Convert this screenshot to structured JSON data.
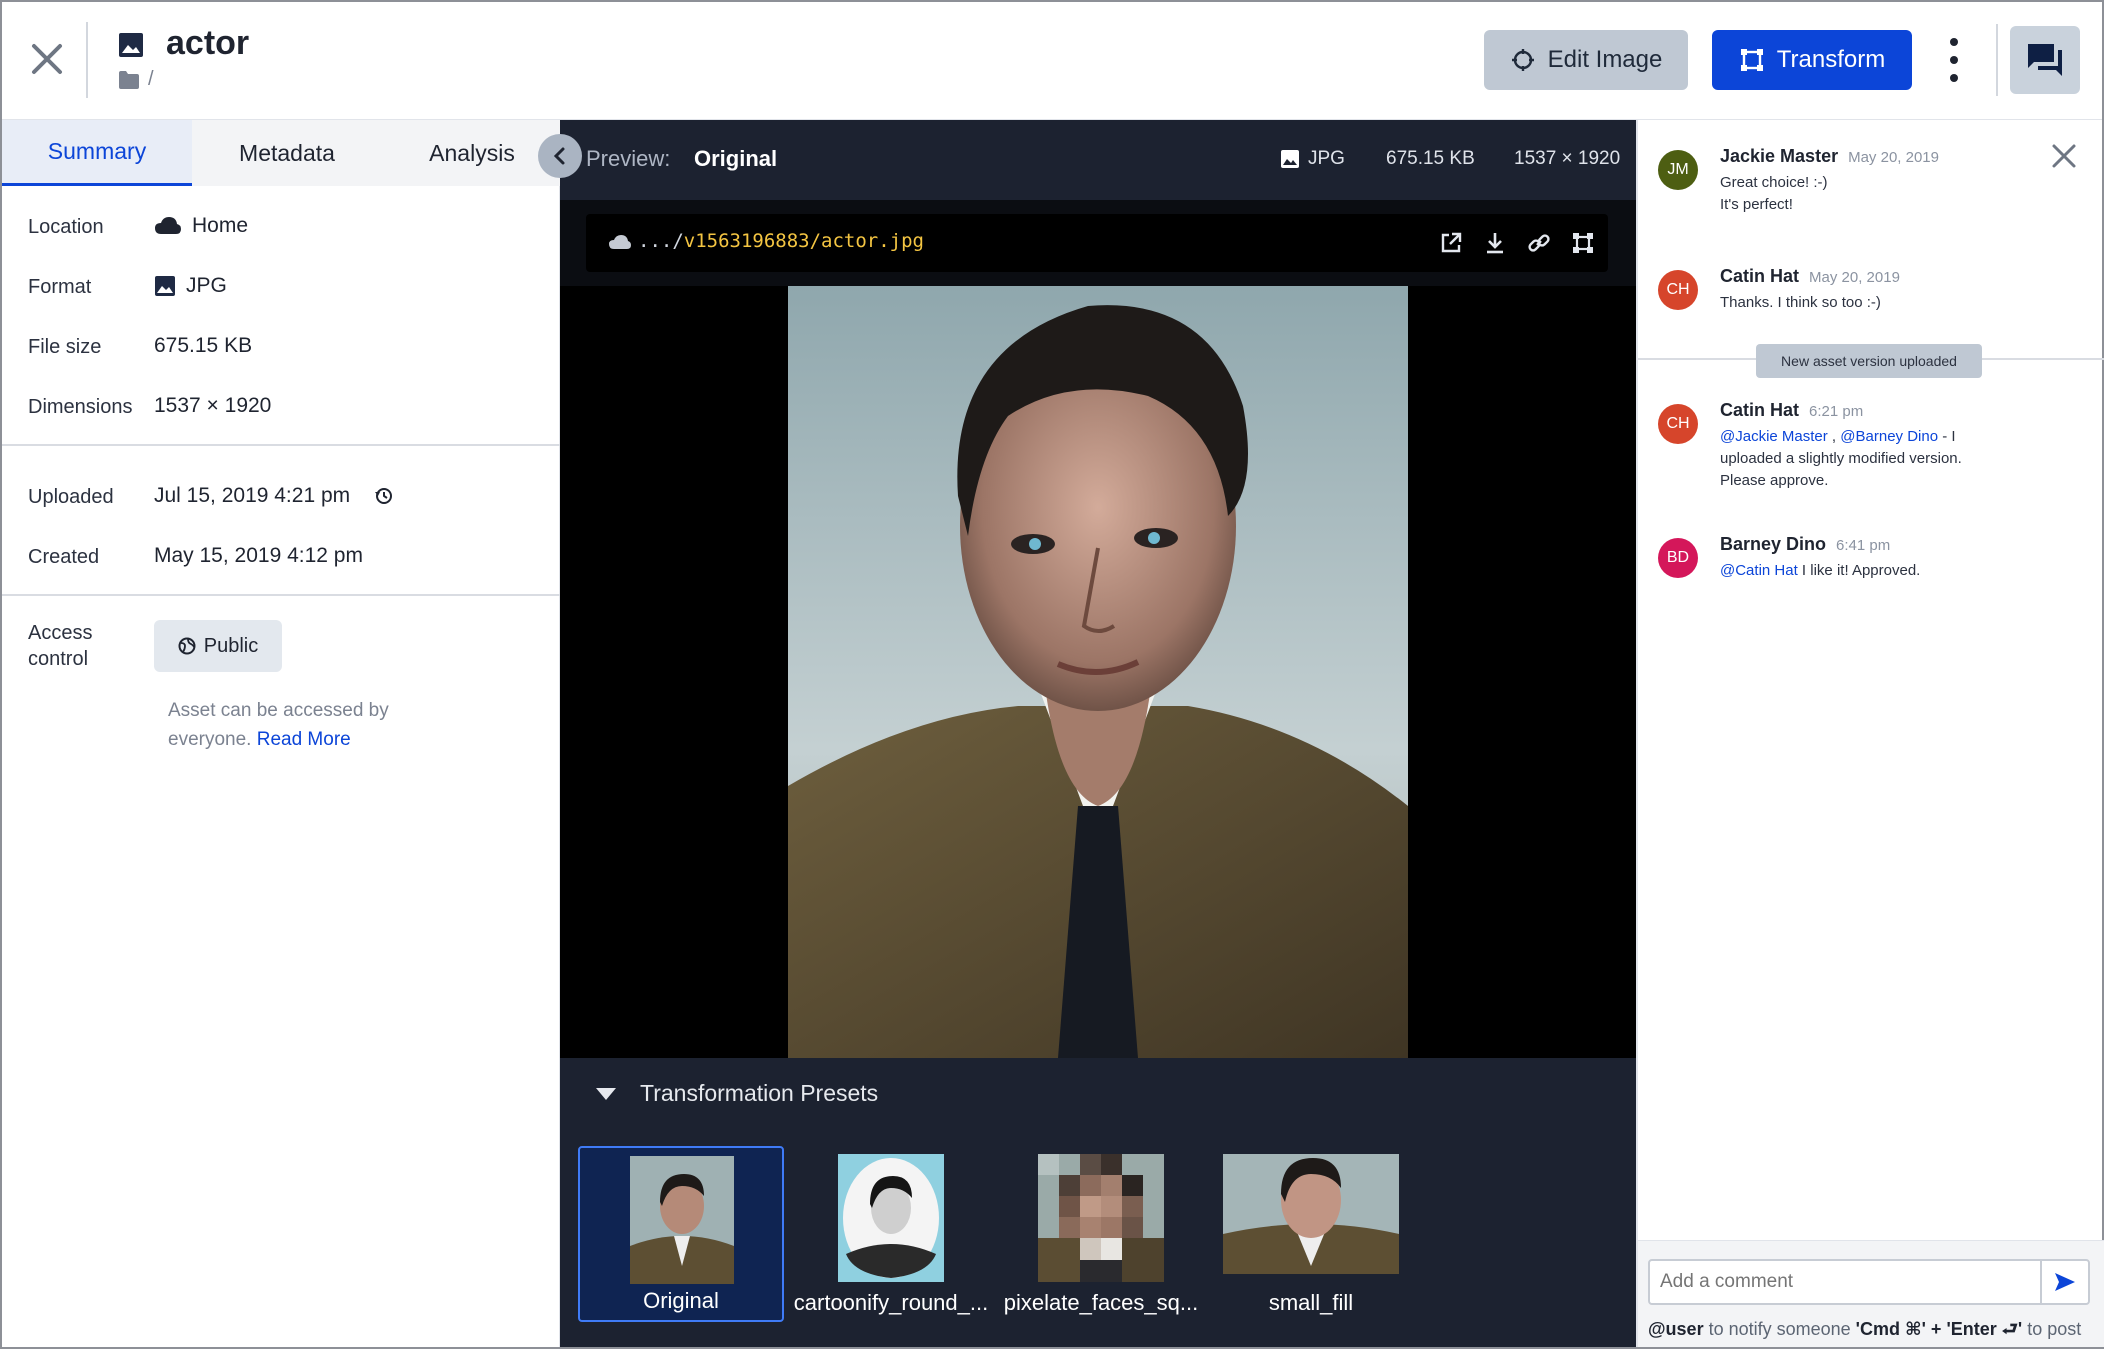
{
  "header": {
    "title": "actor",
    "breadcrumb": "/",
    "edit_button": "Edit Image",
    "transform_button": "Transform"
  },
  "tabs": [
    {
      "label": "Summary",
      "active": true
    },
    {
      "label": "Metadata",
      "active": false
    },
    {
      "label": "Analysis",
      "active": false
    }
  ],
  "summary": {
    "location_label": "Location",
    "location_value": "Home",
    "format_label": "Format",
    "format_value": "JPG",
    "filesize_label": "File size",
    "filesize_value": "675.15 KB",
    "dimensions_label": "Dimensions",
    "dimensions_value": "1537 × 1920",
    "uploaded_label": "Uploaded",
    "uploaded_value": "Jul 15, 2019 4:21 pm",
    "created_label": "Created",
    "created_value": "May 15, 2019 4:12 pm",
    "access_label": "Access control",
    "access_value": "Public",
    "access_note": "Asset can be accessed by everyone.",
    "read_more": "Read More"
  },
  "preview": {
    "label": "Preview:",
    "value": "Original",
    "format": "JPG",
    "size": "675.15 KB",
    "dimensions": "1537 × 1920",
    "url_prefix": ".../",
    "url_path": "v1563196883/actor.jpg"
  },
  "presets": {
    "title": "Transformation Presets",
    "items": [
      {
        "label": "Original",
        "selected": true
      },
      {
        "label": "cartoonify_round_...",
        "selected": false
      },
      {
        "label": "pixelate_faces_sq...",
        "selected": false
      },
      {
        "label": "small_fill",
        "selected": false
      }
    ]
  },
  "comments": [
    {
      "initials": "JM",
      "name": "Jackie Master",
      "date": "May 20, 2019",
      "text": "Great choice! :-) It's perfect!",
      "color": "#4d5e12"
    },
    {
      "initials": "CH",
      "name": "Catin Hat",
      "date": "May 20, 2019",
      "text": "Thanks. I think so too :-)",
      "color": "#d6452b"
    },
    {
      "initials": "CH",
      "name": "Catin Hat",
      "date": "6:21 pm",
      "mention1": "@Jackie Master",
      "sep": " , ",
      "mention2": "@Barney Dino",
      "text": " - I uploaded a slightly modified version. Please approve.",
      "color": "#d6452b"
    },
    {
      "initials": "BD",
      "name": "Barney Dino",
      "date": "6:41 pm",
      "mention1": "@Catin Hat",
      "text": " I like it! Approved.",
      "color": "#d4175a"
    }
  ],
  "version_notice": "New asset version uploaded",
  "comment_box": {
    "placeholder": "Add a comment",
    "hint_user": "@user",
    "hint_notify": " to notify someone  ",
    "hint_keys": "'Cmd ⌘' + 'Enter ⮐'",
    "hint_post": " to post"
  },
  "colors": {
    "accent": "#0c45d8",
    "dark_panel": "#1c2230",
    "highlight_url": "#f4c542"
  },
  "icons": [
    "close-icon",
    "image-icon",
    "folder-icon",
    "edit-image-icon",
    "transform-icon",
    "more-icon",
    "chat-icon",
    "chevron-left-icon",
    "cloud-icon",
    "history-icon",
    "globe-icon",
    "open-external-icon",
    "download-icon",
    "link-icon",
    "crop-icon",
    "caret-down-icon",
    "send-icon"
  ]
}
